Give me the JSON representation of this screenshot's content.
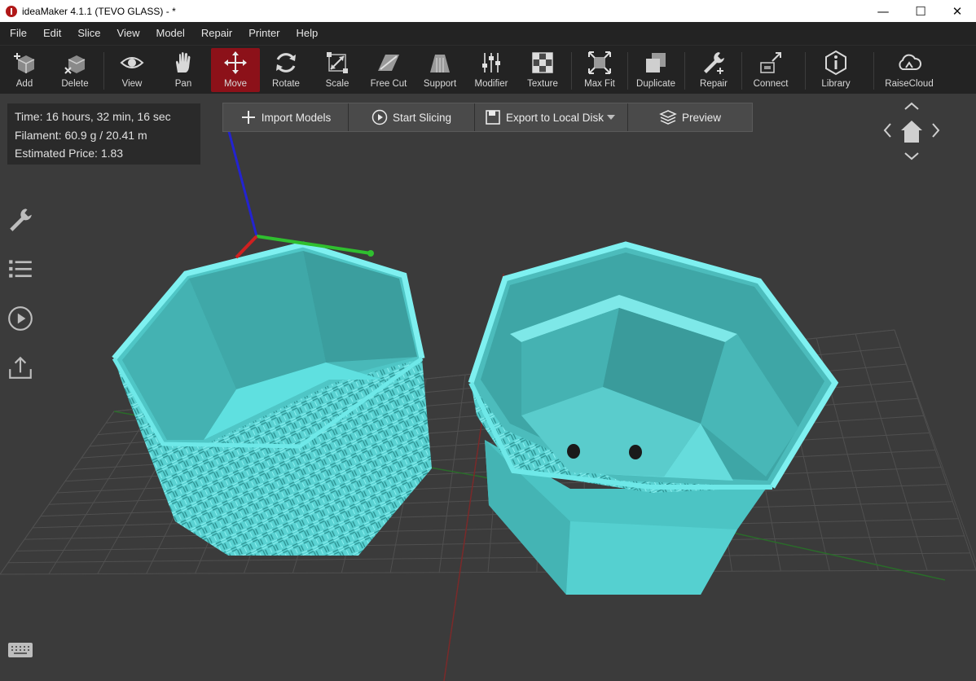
{
  "window": {
    "title": "ideaMaker 4.1.1 (TEVO GLASS) - *"
  },
  "menu": [
    "File",
    "Edit",
    "Slice",
    "View",
    "Model",
    "Repair",
    "Printer",
    "Help"
  ],
  "toolbar": {
    "add": "Add",
    "delete": "Delete",
    "view": "View",
    "pan": "Pan",
    "move": "Move",
    "rotate": "Rotate",
    "scale": "Scale",
    "free_cut": "Free Cut",
    "support": "Support",
    "modifier": "Modifier",
    "texture": "Texture",
    "max_fit": "Max Fit",
    "duplicate": "Duplicate",
    "repair": "Repair",
    "connect": "Connect",
    "library": "Library",
    "raisecloud": "RaiseCloud",
    "active_tool": "Move"
  },
  "info": {
    "time": "Time: 16 hours, 32 min, 16 sec",
    "filament": "Filament: 60.9 g / 20.41 m",
    "price": "Estimated Price: 1.83"
  },
  "actions": {
    "import": "Import Models",
    "slice": "Start Slicing",
    "export": "Export to Local Disk",
    "preview": "Preview"
  },
  "colors": {
    "model": "#5cd6d6",
    "accent_active": "#8c1119",
    "axis_x": "#d02020",
    "axis_y": "#2fbf2f",
    "axis_z": "#2020d0"
  }
}
